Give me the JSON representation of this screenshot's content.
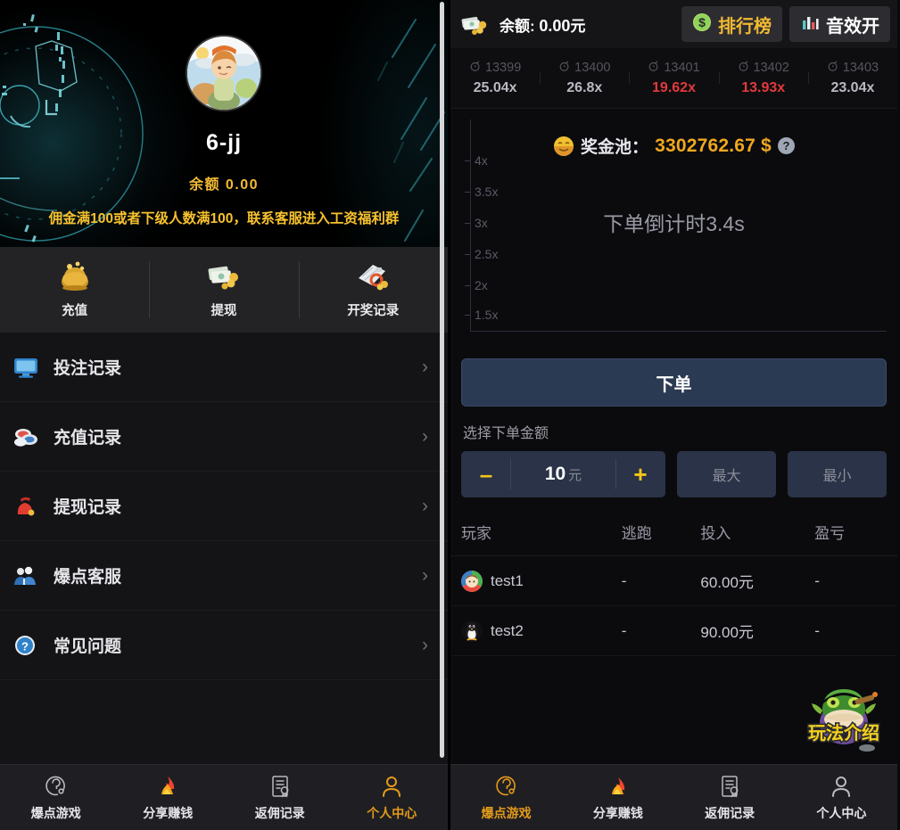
{
  "left": {
    "profile": {
      "avatar_icon": "cartoon-character-avatar",
      "name": "6-jj",
      "balance_label": "余额  0.00",
      "notice": "佣金满100或者下级人数满100，联系客服进入工资福利群"
    },
    "quick_actions": [
      {
        "icon": "money-bag-icon",
        "label": "充值"
      },
      {
        "icon": "cash-withdraw-icon",
        "label": "提现"
      },
      {
        "icon": "lottery-record-icon",
        "label": "开奖记录"
      }
    ],
    "menu": [
      {
        "icon": "monitor-icon",
        "label": "投注记录",
        "chevron": "›"
      },
      {
        "icon": "recharge-record-icon",
        "label": "充值记录",
        "chevron": "›"
      },
      {
        "icon": "red-money-bag-icon",
        "label": "提现记录",
        "chevron": "›"
      },
      {
        "icon": "customer-service-icon",
        "label": "爆点客服",
        "chevron": "›"
      },
      {
        "icon": "question-mark-icon",
        "label": "常见问题",
        "chevron": "›"
      }
    ],
    "bottom_nav": [
      {
        "icon": "question-circle-icon",
        "label": "爆点游戏",
        "active": false
      },
      {
        "icon": "flame-icon",
        "label": "分享赚钱",
        "active": false
      },
      {
        "icon": "document-seal-icon",
        "label": "返佣记录",
        "active": false
      },
      {
        "icon": "person-icon",
        "label": "个人中心",
        "active": true
      }
    ]
  },
  "right": {
    "top_bar": {
      "wallet_icon": "cash-stack-icon",
      "balance_prefix": "余额: ",
      "balance_value": "0.00",
      "balance_unit": "元",
      "rank_button": {
        "icon": "dollar-coin-icon",
        "label": "排行榜"
      },
      "sound_button": {
        "icon": "bar-chart-icon",
        "label": "音效开"
      }
    },
    "rounds": [
      {
        "icon": "bomb-icon",
        "id": "13399",
        "multiplier": "25.04x",
        "hot": false
      },
      {
        "icon": "bomb-icon",
        "id": "13400",
        "multiplier": "26.8x",
        "hot": false
      },
      {
        "icon": "bomb-icon",
        "id": "13401",
        "multiplier": "19.62x",
        "hot": true
      },
      {
        "icon": "bomb-icon",
        "id": "13402",
        "multiplier": "13.93x",
        "hot": true
      },
      {
        "icon": "bomb-icon",
        "id": "13403",
        "multiplier": "23.04x",
        "hot": false
      }
    ],
    "pool": {
      "emoji_icon": "money-face-icon",
      "label": "奖金池：",
      "amount": "3302762.67 $",
      "help_icon": "question-help-icon",
      "help_glyph": "?"
    },
    "countdown_text": "下单倒计时3.4s",
    "bet": {
      "submit_label": "下单",
      "amount_title": "选择下单金额",
      "minus": "–",
      "plus": "+",
      "amount_value": "10",
      "amount_unit": "元",
      "max_label": "最大",
      "min_label": "最小"
    },
    "players_table": {
      "headers": [
        "玩家",
        "逃跑",
        "投入",
        "盈亏"
      ],
      "rows": [
        {
          "avatar": "colorful-face-avatar",
          "name": "test1",
          "escape": "-",
          "invested": "60.00元",
          "profit": "-"
        },
        {
          "avatar": "penguin-avatar",
          "name": "test2",
          "escape": "-",
          "invested": "90.00元",
          "profit": "-"
        }
      ]
    },
    "rules_badge": {
      "icon": "crocodile-mascot-icon",
      "label": "玩法介绍"
    },
    "bottom_nav": [
      {
        "icon": "question-circle-icon",
        "label": "爆点游戏",
        "active": true
      },
      {
        "icon": "flame-icon",
        "label": "分享赚钱",
        "active": false
      },
      {
        "icon": "document-seal-icon",
        "label": "返佣记录",
        "active": false
      },
      {
        "icon": "person-icon",
        "label": "个人中心",
        "active": false
      }
    ]
  },
  "chart_data": {
    "type": "line",
    "title": "",
    "xlabel": "",
    "ylabel": "",
    "yticks": [
      "4x",
      "3.5x",
      "3x",
      "2.5x",
      "2x",
      "1.5x"
    ],
    "ylim": [
      1.25,
      4.25
    ],
    "x": [],
    "values": [],
    "grid": false,
    "legend": "none",
    "note": "下单倒计时3.4s"
  },
  "colors": {
    "accent_gold": "#f0b932",
    "accent_orange": "#e39a1c",
    "hot_red": "#e23a3a",
    "bet_blue": "#2b3a53",
    "panel_dark": "#0b0b0e",
    "nav_bg": "#1f1f23"
  }
}
